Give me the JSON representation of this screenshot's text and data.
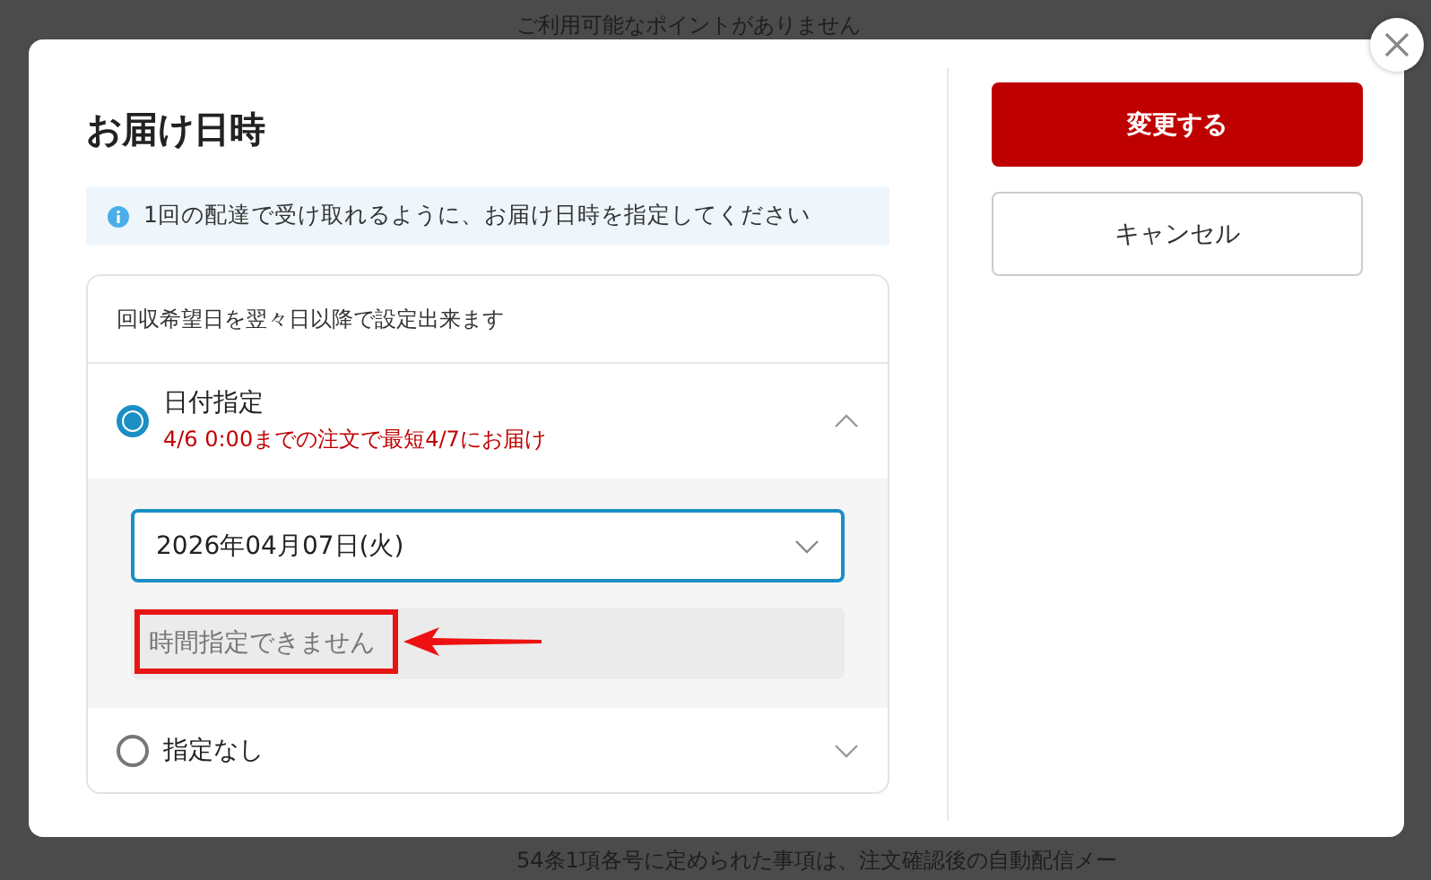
{
  "background": {
    "notice": "ご利用可能なポイントがありません",
    "footer_text": "54条1項各号に定められた事項は、注文確認後の自動配信メー"
  },
  "dialog": {
    "title": "お届け日時",
    "info": "1回の配達で受け取れるように、お届け日時を指定してください",
    "panel_note": "回収希望日を翌々日以降で設定出来ます",
    "options": [
      {
        "label": "日付指定",
        "sub": "4/6 0:00までの注文で最短4/7にお届け",
        "selected": true,
        "expanded": true,
        "date_select": {
          "value": "2026年04月07日(火)"
        },
        "time_select": {
          "value": "時間指定できません",
          "disabled": true
        }
      },
      {
        "label": "指定なし",
        "selected": false,
        "expanded": false
      }
    ],
    "buttons": [
      {
        "label": "変更する",
        "kind": "primary"
      },
      {
        "label": "キャンセル",
        "kind": "secondary"
      }
    ]
  }
}
